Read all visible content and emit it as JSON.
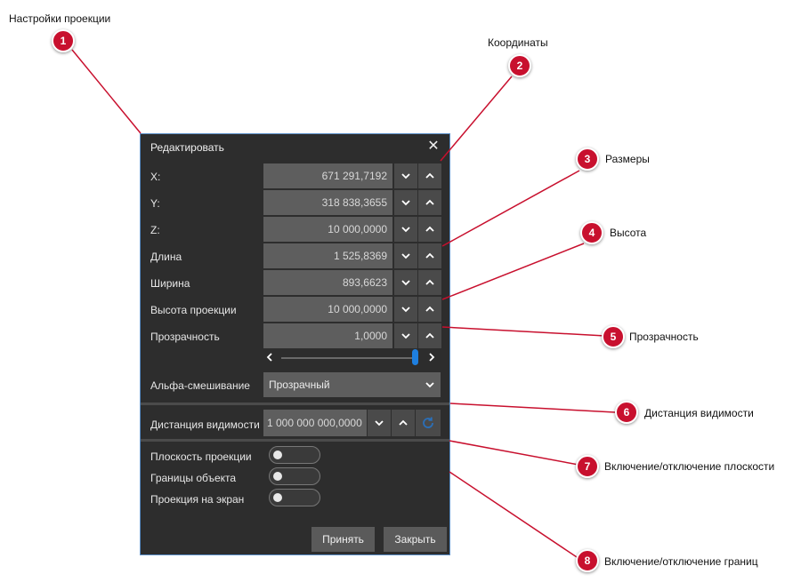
{
  "dialog": {
    "title": "Редактировать",
    "fields": [
      {
        "label": "X:",
        "value": "671 291,7192"
      },
      {
        "label": "Y:",
        "value": "318 838,3655"
      },
      {
        "label": "Z:",
        "value": "10 000,0000"
      },
      {
        "label": "Длина",
        "value": "1 525,8369"
      },
      {
        "label": "Ширина",
        "value": "893,6623"
      },
      {
        "label": "Высота проекции",
        "value": "10 000,0000"
      },
      {
        "label": "Прозрачность",
        "value": "1,0000"
      }
    ],
    "opacity_slider_value": 1.0,
    "blend": {
      "label": "Альфа-смешивание",
      "value": "Прозрачный"
    },
    "visibility": {
      "label": "Дистанция видимости",
      "value": "1 000 000 000,0000"
    },
    "toggles": [
      {
        "label": "Плоскость проекции",
        "on": false
      },
      {
        "label": "Границы объекта",
        "on": false
      },
      {
        "label": "Проекция на экран",
        "on": false
      }
    ],
    "buttons": {
      "accept": "Принять",
      "close": "Закрыть"
    }
  },
  "annotations": [
    {
      "num": "1",
      "text": "Настройки проекции"
    },
    {
      "num": "2",
      "text": "Координаты"
    },
    {
      "num": "3",
      "text": "Размеры"
    },
    {
      "num": "4",
      "text": "Высота"
    },
    {
      "num": "5",
      "text": "Прозрачность"
    },
    {
      "num": "6",
      "text": "Дистанция видимости"
    },
    {
      "num": "7",
      "text": "Включение/отключение плоскости"
    },
    {
      "num": "8",
      "text": "Включение/отключение границ"
    }
  ],
  "colors": {
    "accent": "#c8102e",
    "panel": "#2d2d2d",
    "field": "#5e5e5e",
    "slider": "#1e7fe0"
  }
}
